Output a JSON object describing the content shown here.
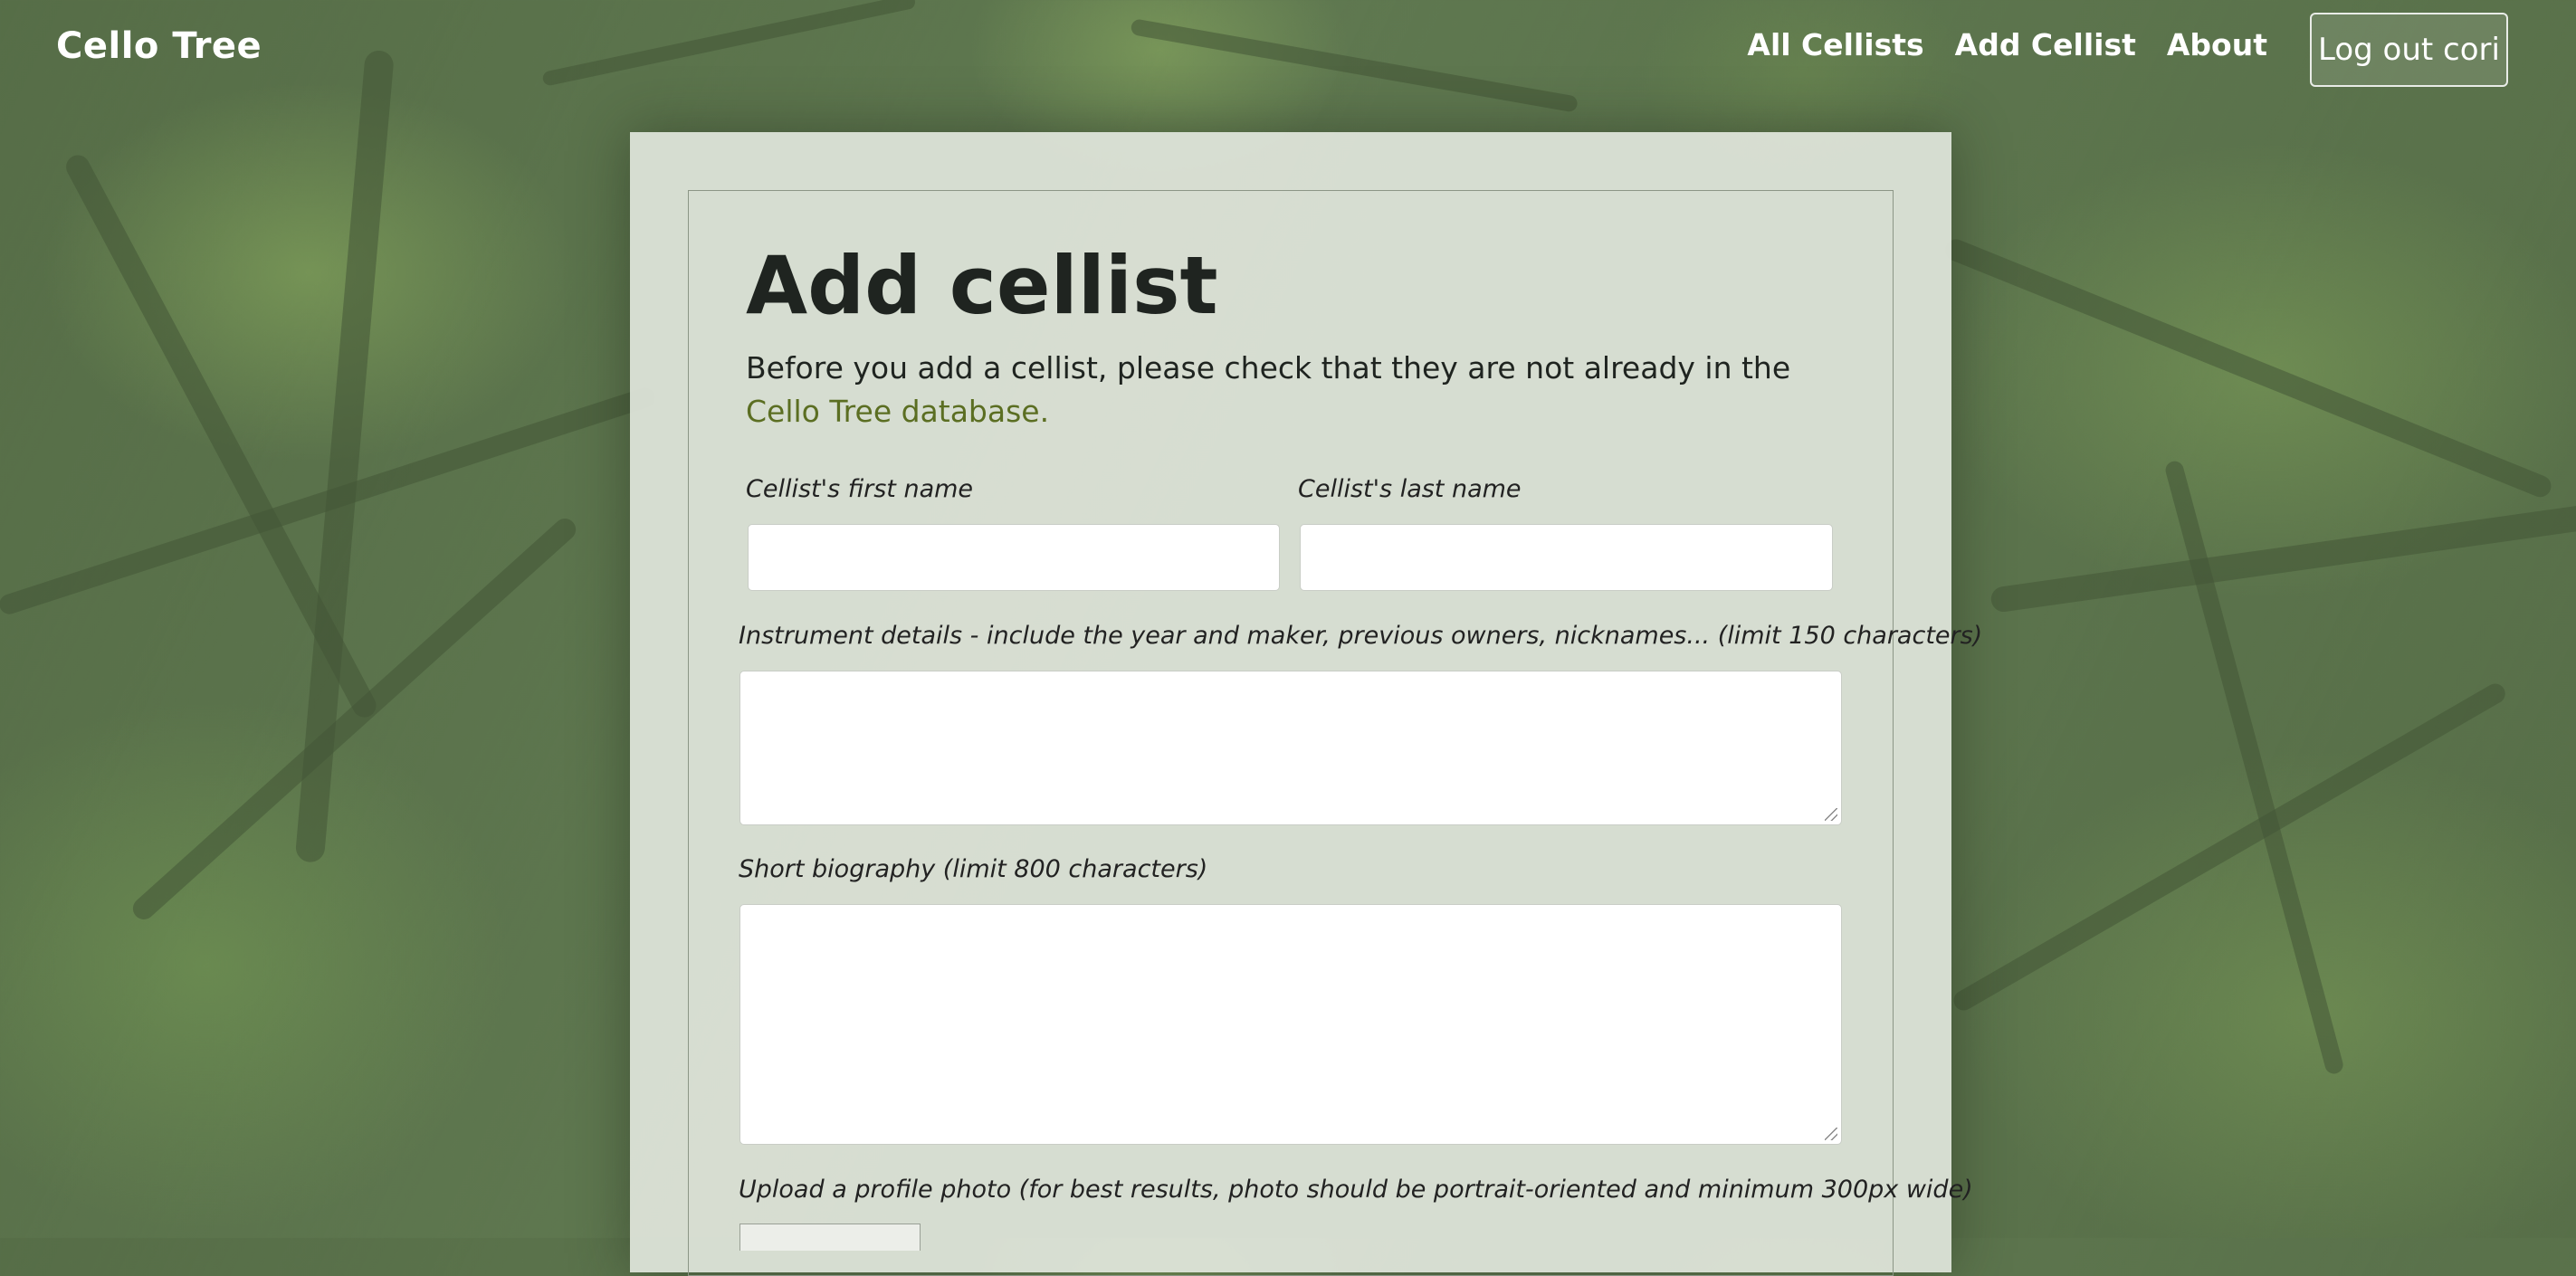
{
  "nav": {
    "brand": "Cello Tree",
    "links": [
      "All Cellists",
      "Add Cellist",
      "About"
    ],
    "logout_label": "Log out cori"
  },
  "form": {
    "title": "Add cellist",
    "intro_text": "Before you add a cellist, please check that they are not already in the ",
    "intro_link": "Cello Tree database.",
    "first_name_label": "Cellist's first name",
    "first_name_value": "",
    "last_name_label": "Cellist's last name",
    "last_name_value": "",
    "instrument_label": "Instrument details - include the year and maker, previous owners, nicknames... (limit 150 characters)",
    "instrument_value": "",
    "biography_label": "Short biography (limit 800 characters)",
    "biography_value": "",
    "photo_label": "Upload a profile photo (for best results, photo should be portrait-oriented and minimum 300px wide)"
  },
  "colors": {
    "accent_link": "#5b6e22",
    "background": "#5f7850",
    "card": "#e0e5dc"
  }
}
